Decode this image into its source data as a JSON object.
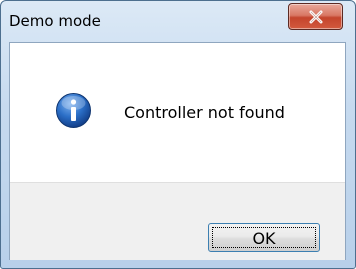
{
  "dialog": {
    "title": "Demo mode",
    "message": "Controller not found",
    "ok_label": "OK",
    "icons": {
      "info": "information-icon",
      "close": "close-icon"
    },
    "colors": {
      "close_button": "#c4442c",
      "info_icon": "#1d5fb6",
      "ok_border": "#3c7fb1"
    }
  }
}
